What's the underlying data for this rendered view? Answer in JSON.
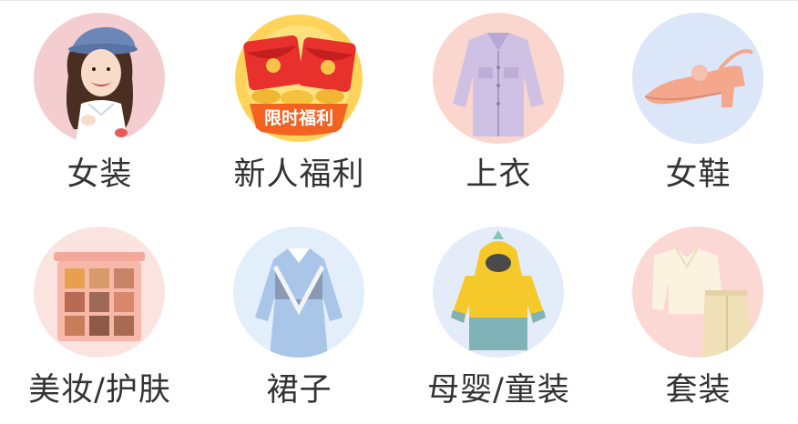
{
  "colors": {
    "label_text": "#333333",
    "divider": "#e6e6e6"
  },
  "categories": [
    {
      "label": "女装",
      "icon": "woman-model-icon",
      "bg": "#f3cdd0"
    },
    {
      "label": "新人福利",
      "icon": "red-envelope-icon",
      "bg": "#ffffff",
      "badge": "限时福利"
    },
    {
      "label": "上衣",
      "icon": "jacket-icon",
      "bg": "#fbd6cf"
    },
    {
      "label": "女鞋",
      "icon": "heel-shoe-icon",
      "bg": "#dbe6f8"
    },
    {
      "label": "美妆/护肤",
      "icon": "eyeshadow-palette-icon",
      "bg": "#fbe4e0"
    },
    {
      "label": "裙子",
      "icon": "dress-icon",
      "bg": "#e3eefb"
    },
    {
      "label": "母婴/童装",
      "icon": "kids-hoodie-icon",
      "bg": "#e4ecfa"
    },
    {
      "label": "套装",
      "icon": "outfit-set-icon",
      "bg": "#fcd8d4"
    }
  ]
}
